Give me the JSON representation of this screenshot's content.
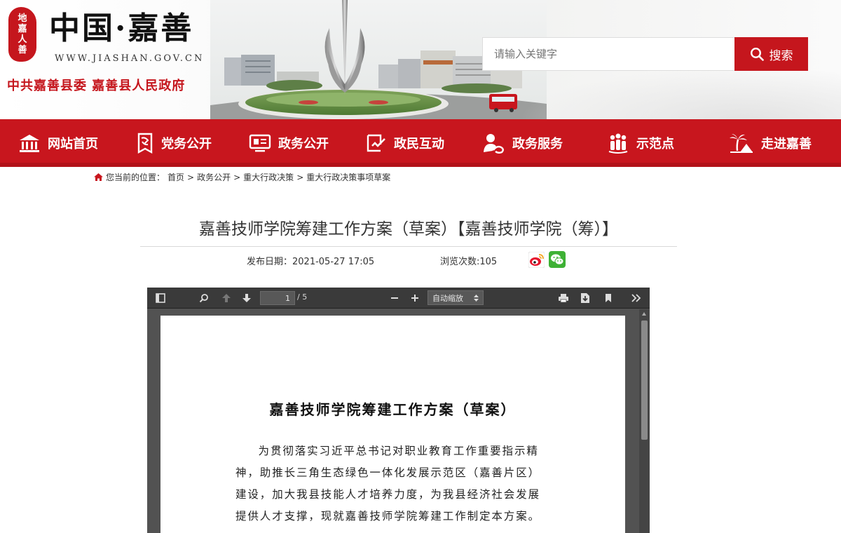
{
  "header": {
    "seal_chars": [
      "地",
      "嘉",
      "人",
      "善"
    ],
    "brand_name": "中国·嘉善",
    "brand_url": "WWW.JIASHAN.GOV.CN",
    "brand_sub": "中共嘉善县委  嘉善县人民政府",
    "search_placeholder": "请输入关键字",
    "search_button": "搜索"
  },
  "nav": {
    "items": [
      {
        "label": "网站首页",
        "icon": "home-icon"
      },
      {
        "label": "党务公开",
        "icon": "party-icon"
      },
      {
        "label": "政务公开",
        "icon": "monitor-icon"
      },
      {
        "label": "政民互动",
        "icon": "interaction-icon"
      },
      {
        "label": "政务服务",
        "icon": "service-icon"
      },
      {
        "label": "示范点",
        "icon": "people-icon"
      },
      {
        "label": "走进嘉善",
        "icon": "palm-icon"
      }
    ]
  },
  "breadcrumb": {
    "prefix": "您当前的位置：",
    "items": [
      "首页",
      "政务公开",
      "重大行政决策",
      "重大行政决策事项草案"
    ],
    "separator": ">"
  },
  "article": {
    "title": "嘉善技师学院筹建工作方案（草案）【嘉善技师学院（筹）】",
    "publish_date_label": "发布日期：",
    "publish_date": "2021-05-27 17:05",
    "views_label": "浏览次数:",
    "views": "105"
  },
  "pdf_viewer": {
    "current_page": "1",
    "page_total": "/ 5",
    "zoom": "自动缩放",
    "doc_title": "嘉善技师学院筹建工作方案（草案）",
    "doc_body": "为贯彻落实习近平总书记对职业教育工作重要指示精神，助推长三角生态绿色一体化发展示范区（嘉善片区）建设，加大我县技能人才培养力度，为我县经济社会发展提供人才支撑，现就嘉善技师学院筹建工作制定本方案。"
  },
  "colors": {
    "brand_red": "#c8161e",
    "nav_bg": "#c8161e"
  }
}
